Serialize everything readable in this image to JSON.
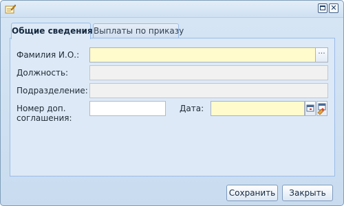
{
  "window": {
    "title": ""
  },
  "tabs": [
    {
      "label": "Общие сведения",
      "active": true
    },
    {
      "label": "Выплаты по приказу",
      "active": false
    }
  ],
  "form": {
    "fio": {
      "label": "Фамилия И.О.:",
      "value": "",
      "required": true
    },
    "position": {
      "label": "Должность:",
      "value": ""
    },
    "department": {
      "label": "Подразделение:",
      "value": ""
    },
    "agreement_number": {
      "label_line1": "Номер доп.",
      "label_line2": "соглашения:",
      "value": ""
    },
    "date": {
      "label": "Дата:",
      "value": "",
      "required": true
    }
  },
  "icons": {
    "window": "edit-window-icon",
    "picker": "ellipsis-icon",
    "calendar": "calendar-icon",
    "clear": "clear-date-icon"
  },
  "buttons": {
    "save": "Сохранить",
    "close": "Закрыть"
  },
  "colors": {
    "required_bg": "#fffbcc",
    "readonly_bg": "#f1f1f1",
    "window_bg": "#c9dcef"
  }
}
